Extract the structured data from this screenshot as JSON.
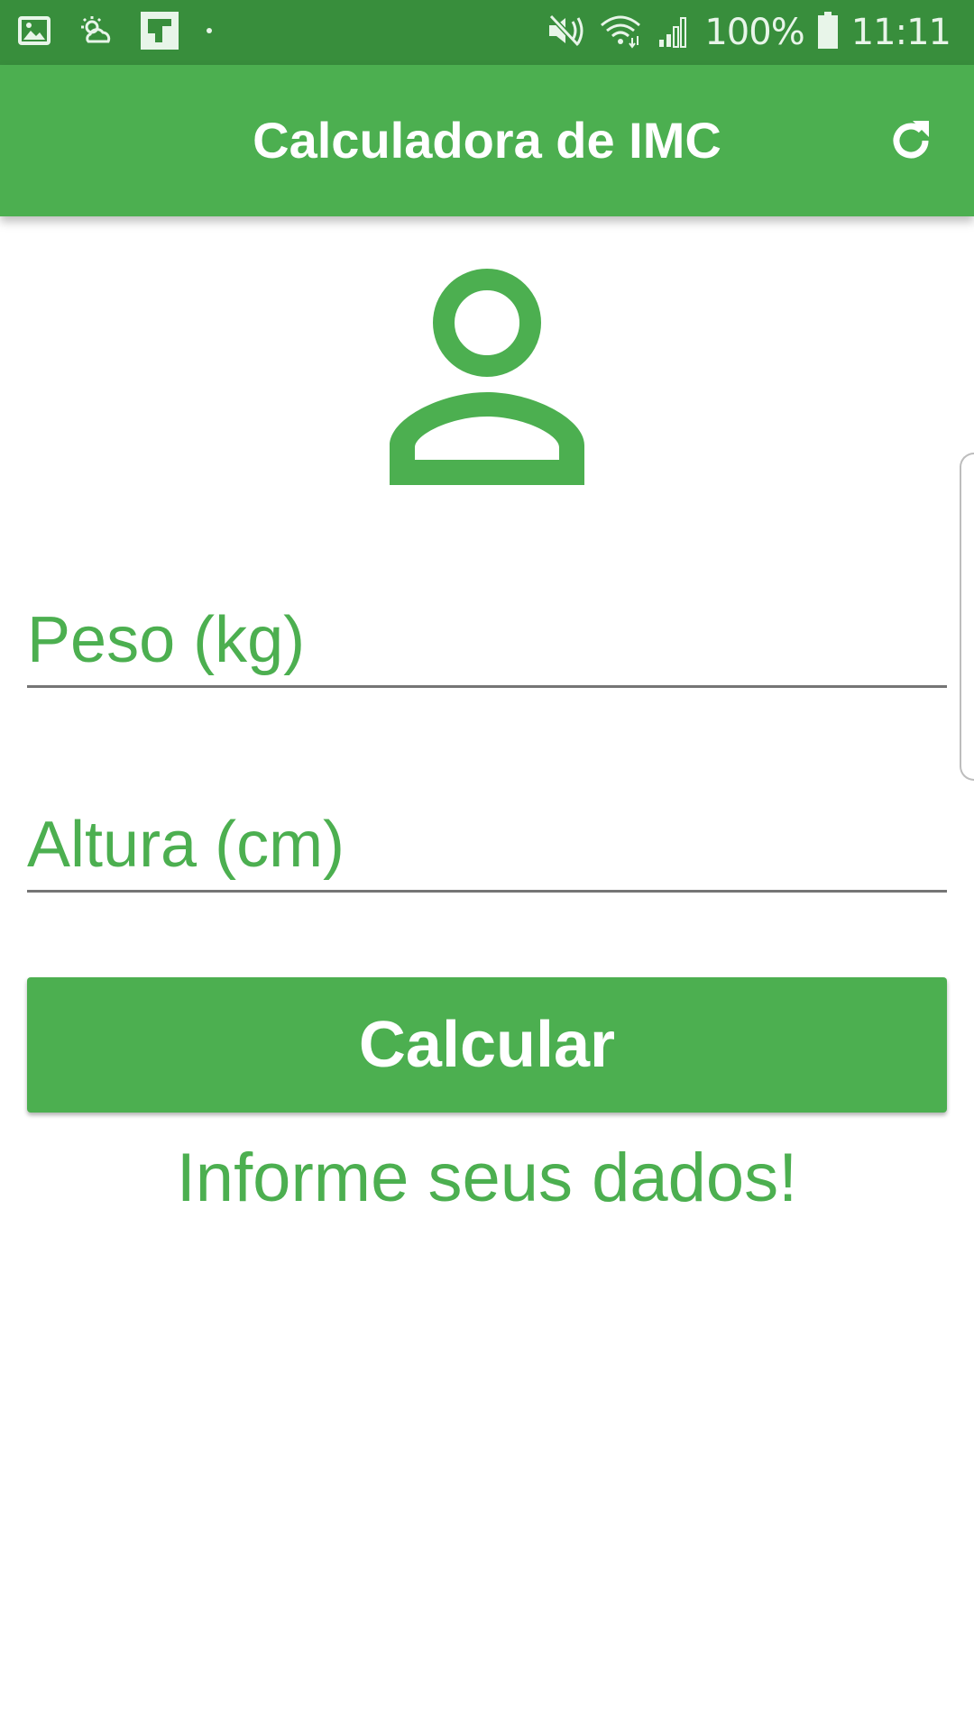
{
  "status_bar": {
    "battery": "100%",
    "time": "11:11",
    "icons": [
      "gallery-icon",
      "weather-icon",
      "flipboard-icon",
      "dot-icon",
      "mute-icon",
      "wifi-icon",
      "signal-icon",
      "battery-icon"
    ]
  },
  "app_bar": {
    "title": "Calculadora de IMC",
    "refresh_icon": "refresh-icon"
  },
  "avatar_icon": "person-outline-icon",
  "form": {
    "weight_placeholder": "Peso (kg)",
    "weight_value": "",
    "height_placeholder": "Altura (cm)",
    "height_value": ""
  },
  "calculate_label": "Calcular",
  "info_text": "Informe seus dados!",
  "colors": {
    "primary": "#4caf50",
    "primary_dark": "#388e3c",
    "underline": "#757575"
  }
}
